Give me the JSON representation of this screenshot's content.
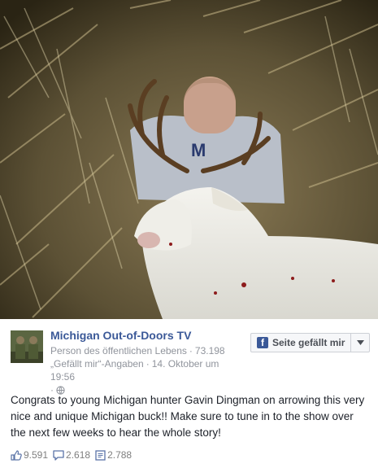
{
  "photo": {
    "alt": "Boy kneeling behind a white buck lying in tall dry grass"
  },
  "page": {
    "name": "Michigan Out-of-Doors TV",
    "category": "Person des öffentlichen Lebens",
    "likes_count": "73.198",
    "likes_label": "„Gefällt mir“-Angaben",
    "date": "14. Oktober um 19:56",
    "separator": "·"
  },
  "like_button": {
    "label": "Seite gefällt mir",
    "logo_letter": "f"
  },
  "post": {
    "text": "Congrats to young Michigan hunter Gavin Dingman on arrowing this very nice and unique Michigan buck!! Make sure to tune in to the show over the next few weeks to hear the whole story!"
  },
  "stats": {
    "likes": "9.591",
    "comments": "2.618",
    "shares": "2.788"
  },
  "colors": {
    "link_blue": "#3b5998",
    "meta_gray": "#90949c",
    "text": "#1d2129"
  },
  "icons": [
    "facebook-logo-icon",
    "chevron-down-icon",
    "globe-icon",
    "thumbs-up-icon",
    "comment-icon",
    "share-icon"
  ]
}
